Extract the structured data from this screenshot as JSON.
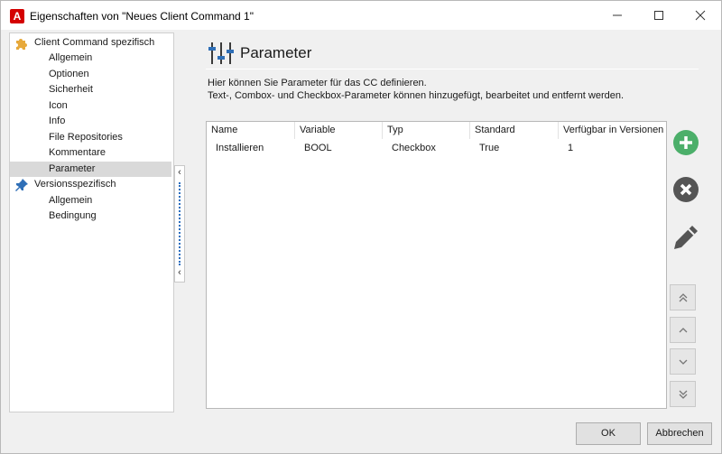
{
  "window": {
    "app_icon_letter": "A",
    "title": "Eigenschaften von \"Neues Client Command 1\""
  },
  "sidebar": {
    "groups": [
      {
        "label": "Client Command spezifisch",
        "icon": "puzzle-icon",
        "items": [
          "Allgemein",
          "Optionen",
          "Sicherheit",
          "Icon",
          "Info",
          "File Repositories",
          "Kommentare",
          "Parameter"
        ]
      },
      {
        "label": "Versionsspezifisch",
        "icon": "pin-icon",
        "items": [
          "Allgemein",
          "Bedingung"
        ]
      }
    ],
    "selected": "Parameter"
  },
  "content": {
    "title": "Parameter",
    "description_line1": "Hier können Sie Parameter für das CC definieren.",
    "description_line2": "Text-, Combox- und Checkbox-Parameter können hinzugefügt, bearbeitet und entfernt werden.",
    "table": {
      "columns": [
        "Name",
        "Variable",
        "Typ",
        "Standard",
        "Verfügbar in Versionen"
      ],
      "rows": [
        [
          "Installieren",
          "BOOL",
          "Checkbox",
          "True",
          "1"
        ]
      ]
    }
  },
  "actions": {
    "add_icon": "plus-circle-icon",
    "remove_icon": "x-circle-icon",
    "edit_icon": "pencil-icon",
    "colors": {
      "add": "#4caf6a",
      "remove": "#555555",
      "edit": "#555555"
    }
  },
  "footer": {
    "ok_label": "OK",
    "cancel_label": "Abbrechen"
  }
}
